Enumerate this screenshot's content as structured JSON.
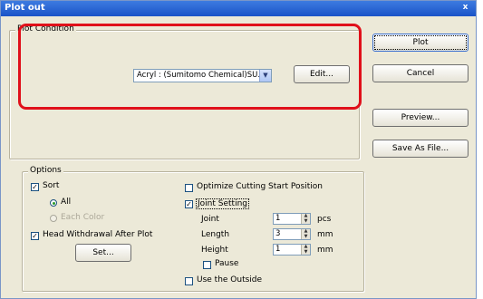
{
  "window": {
    "title": "Plot out",
    "close_glyph": "x"
  },
  "plot_condition": {
    "label": "Plot Condition",
    "media_value": "Acryl : (Sumitomo Chemical)SU...",
    "edit_label": "Edit..."
  },
  "buttons": {
    "plot": "Plot",
    "cancel": "Cancel",
    "preview": "Preview...",
    "save_as_file": "Save As File..."
  },
  "options": {
    "label": "Options",
    "sort": {
      "label": "Sort",
      "checked": true
    },
    "sort_all": {
      "label": "All",
      "selected": true
    },
    "sort_each_color": {
      "label": "Each Color",
      "selected": false,
      "disabled": true
    },
    "head_withdrawal": {
      "label": "Head Withdrawal After Plot",
      "checked": true
    },
    "set_label": "Set...",
    "optimize": {
      "label": "Optimize Cutting Start Position",
      "checked": false
    },
    "joint_setting": {
      "label": "Joint Setting",
      "checked": true
    },
    "joint": {
      "label": "Joint",
      "value": "1",
      "unit": "pcs"
    },
    "length": {
      "label": "Length",
      "value": "3",
      "unit": "mm"
    },
    "height": {
      "label": "Height",
      "value": "1",
      "unit": "mm"
    },
    "pause": {
      "label": "Pause",
      "checked": false
    },
    "use_outside": {
      "label": "Use the Outside",
      "checked": false
    }
  },
  "colors": {
    "highlight": "#e0101a",
    "titlebar": "#1a53c8",
    "dialog_bg": "#ece9d8"
  }
}
